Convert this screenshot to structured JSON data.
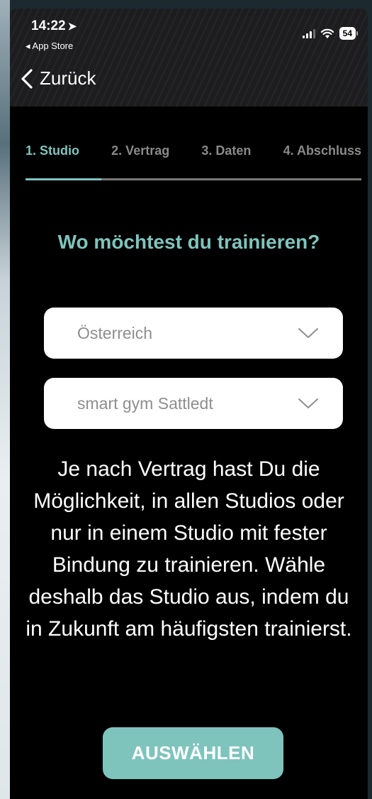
{
  "status_bar": {
    "time": "14:22",
    "back_app": "◂ App Store",
    "battery": "54"
  },
  "nav": {
    "back_label": "Zurück"
  },
  "steps": [
    {
      "label": "1. Studio",
      "active": true
    },
    {
      "label": "2. Vertrag",
      "active": false
    },
    {
      "label": "3. Daten",
      "active": false
    },
    {
      "label": "4. Abschluss",
      "active": false
    }
  ],
  "progress": {
    "current_step": 1,
    "total_steps": 4
  },
  "question": "Wo möchtest du trainieren?",
  "country_select": {
    "value": "Österreich"
  },
  "studio_select": {
    "value": "smart gym Sattledt"
  },
  "info_text": "Je nach Vertrag hast Du die Möglichkeit, in allen Studios oder nur in einem Studio mit fester Bindung zu trainieren. Wähle deshalb das Studio aus, indem du in Zukunft am häufigsten trainierst.",
  "submit_label": "AUSWÄHLEN",
  "colors": {
    "accent": "#7ec4bd",
    "background": "#000000",
    "inactive_step": "#8a8a8a"
  }
}
